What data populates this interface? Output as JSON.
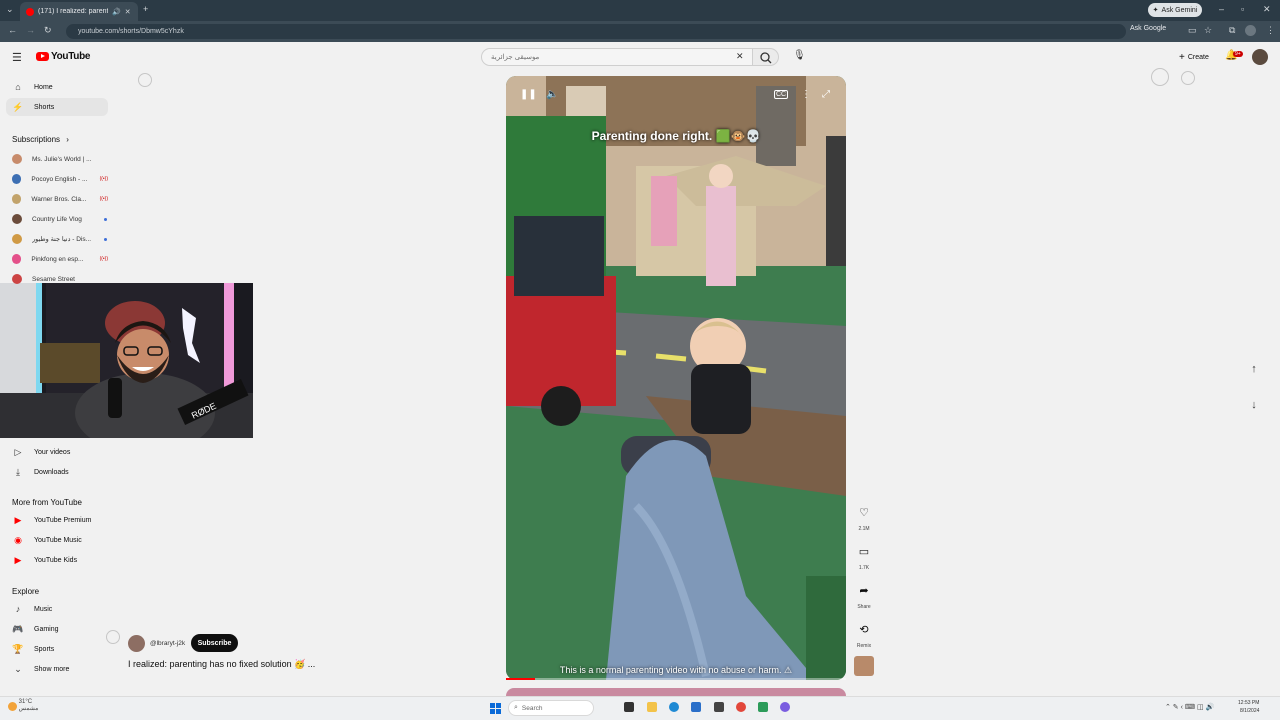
{
  "browser": {
    "tab_title": "(171) I realized: parenting I",
    "url": "youtube.com/shorts/Dbmw5cYhzk",
    "ask_gemini": "Ask Gemini",
    "ask_google": "Ask Google"
  },
  "header": {
    "logo_text": "YouTube",
    "search_placeholder": "موسيقى جزائرية",
    "create_label": "Create",
    "notif_count": "9+"
  },
  "sidebar": {
    "main": [
      {
        "label": "Home",
        "icon": "home-icon"
      },
      {
        "label": "Shorts",
        "icon": "shorts-icon"
      }
    ],
    "subscriptions_title": "Subscriptions",
    "subscriptions": [
      {
        "name": "Ms. Julie's World | ...",
        "color": "#c78b6b",
        "status": "none"
      },
      {
        "name": "Pocoyo English - ...",
        "color": "#3d6fb3",
        "status": "live"
      },
      {
        "name": "Warner Bros. Cla...",
        "color": "#c2a36b",
        "status": "live"
      },
      {
        "name": "Country Life Vlog",
        "color": "#6b4c3b",
        "status": "dot"
      },
      {
        "name": "دنيا جنة وطيور - Dis...",
        "color": "#d09a45",
        "status": "dot"
      },
      {
        "name": "Pinkfong en esp...",
        "color": "#e4518a",
        "status": "live"
      },
      {
        "name": "Sesame Street",
        "color": "#c44",
        "status": "none"
      }
    ],
    "you_items": [
      {
        "label": "Your videos",
        "icon": "play-square-icon"
      },
      {
        "label": "Downloads",
        "icon": "download-icon"
      }
    ],
    "more_title": "More from YouTube",
    "more_items": [
      {
        "label": "YouTube Premium",
        "color": "#ff0000"
      },
      {
        "label": "YouTube Music",
        "color": "#ff0000"
      },
      {
        "label": "YouTube Kids",
        "color": "#ff0000"
      }
    ],
    "explore_title": "Explore",
    "explore_items": [
      {
        "label": "Music",
        "icon": "music-icon"
      },
      {
        "label": "Gaming",
        "icon": "gaming-icon"
      },
      {
        "label": "Sports",
        "icon": "trophy-icon"
      },
      {
        "label": "Show more",
        "icon": "chevron-down-icon"
      }
    ]
  },
  "video": {
    "caption_top": "Parenting done right. 🟩🐵💀",
    "caption_bottom": "This is a normal parenting video with no abuse or harm. ⚠",
    "progress": 0.085
  },
  "actions": {
    "likes": "2.1M",
    "comments": "1.7K",
    "share": "Share",
    "remix": "Remix"
  },
  "channel": {
    "handle": "@lbraryt-j2k",
    "subscribe": "Subscribe",
    "title": "I realized: parenting has no fixed solution 🥳 ..."
  },
  "taskbar": {
    "weather_temp": "31°C",
    "weather_desc": "مشمس",
    "search": "Search",
    "time": "12:53 PM",
    "date": "8/1/2024"
  }
}
